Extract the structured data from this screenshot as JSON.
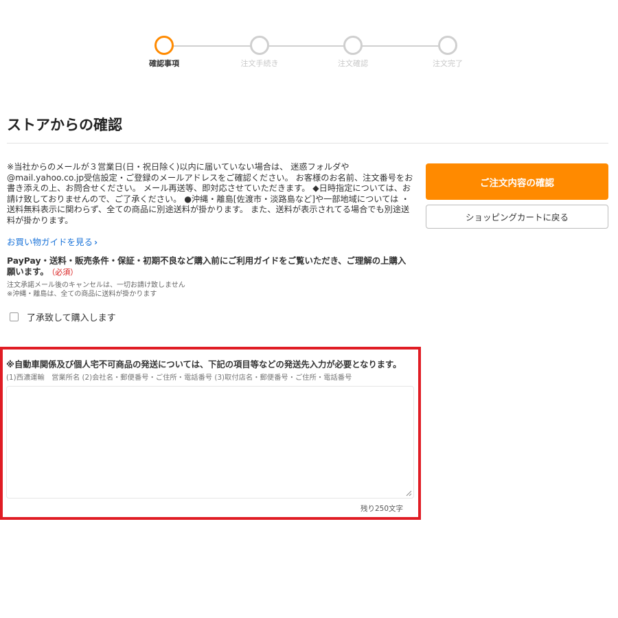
{
  "steps": [
    {
      "label": "確認事項",
      "active": true
    },
    {
      "label": "注文手続き",
      "active": false
    },
    {
      "label": "注文確認",
      "active": false
    },
    {
      "label": "注文完了",
      "active": false
    }
  ],
  "page": {
    "title": "ストアからの確認",
    "notice": "※当社からのメールが３営業日(日・祝日除く)以内に届いていない場合は、 迷惑フォルダや@mail.yahoo.co.jp受信設定・ご登録のメールアドレスをご確認ください。 お客様のお名前、注文番号をお書き添えの上、お問合せください。 メール再送等、即対応させていただきます。 ◆日時指定については、お請け致しておりませんので、ご了承ください。 ●沖縄・離島[佐渡市・淡路島など]や一部地域については ・送料無料表示に関わらず、全ての商品に別途送料が掛かります。 また、送料が表示されてる場合でも別途送料が掛かります。"
  },
  "guide": {
    "link_label": "お買い物ガイドを見る",
    "chevron": "›",
    "text": "PayPay・送料・販売条件・保証・初期不良など購入前にご利用ガイドをご覧いただき、ご理解の上購入願います。",
    "required_label": "（必須）",
    "note_line1": "注文承諾メール後のキャンセルは、一切お請け致しません",
    "note_line2": "※沖縄・離島は、全ての商品に送料が掛かります",
    "agree_label": "了承致して購入します"
  },
  "actions": {
    "confirm_label": "ご注文内容の確認",
    "back_label": "ショッピングカートに戻る"
  },
  "shipping": {
    "heading": "※自動車関係及び個人宅不可商品の発送については、下記の項目等などの発送先入力が必要となります。",
    "sub": "(1)西濃運輸　営業所名 (2)会社名・郵便番号・ご住所・電話番号 (3)取付店名・郵便番号・ご住所・電話番号",
    "value": "",
    "char_count": "残り250文字"
  },
  "colors": {
    "accent": "#ff8a00",
    "highlight": "#e01c24",
    "link": "#1a73d9",
    "required": "#d81b1b"
  }
}
